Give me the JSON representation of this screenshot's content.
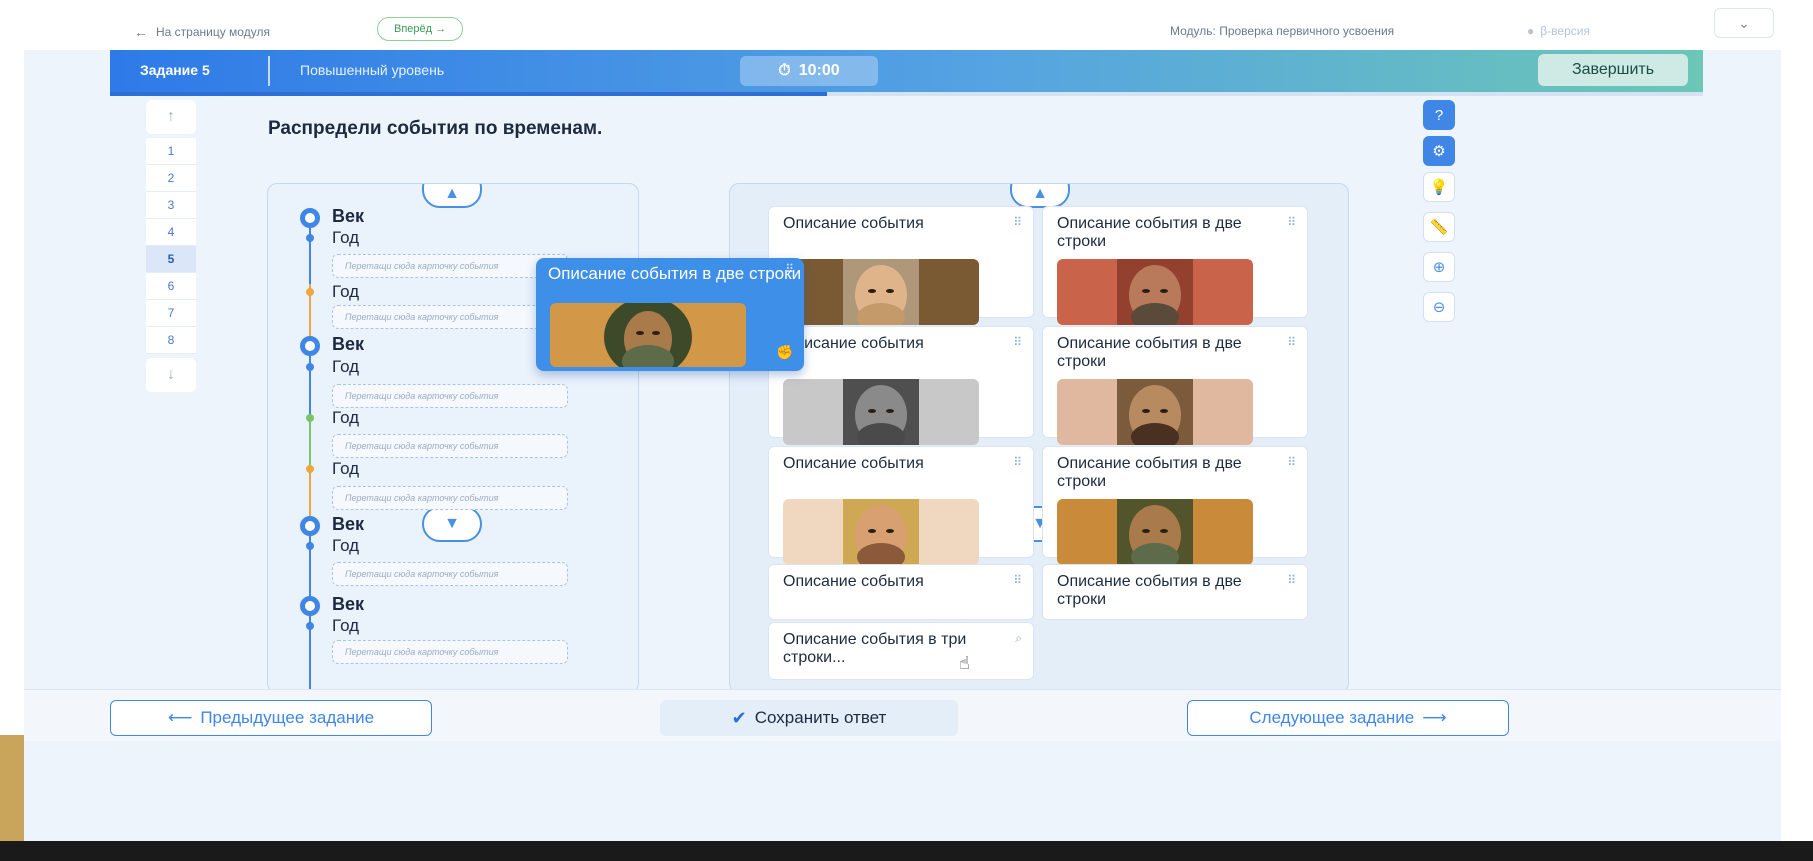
{
  "topnav": {
    "back_label": "На страницу модуля",
    "forward_label": "Вперёд",
    "module_label": "Модуль: Проверка первичного усвоения",
    "beta_label": "β-версия"
  },
  "header": {
    "task_num": "Задание 5",
    "level": "Повышенный уровень",
    "timer": "10:00",
    "finish_label": "Завершить",
    "progress_fraction": 0.45
  },
  "task_nav": {
    "items": [
      "1",
      "2",
      "3",
      "4",
      "5",
      "6",
      "7",
      "8"
    ],
    "active": "5"
  },
  "question": "Распредели события по временам.",
  "timeline": {
    "century_label": "Век",
    "year_label": "Год",
    "drop_hint": "Перетащи сюда карточку события"
  },
  "cards": {
    "one_line": "Описание события",
    "two_lines": "Описание события в две строки",
    "three_lines": "Описание события в три строки..."
  },
  "dragged_card": {
    "caption": "Описание события в две строки"
  },
  "bottom": {
    "prev_label": "Предыдущее задание",
    "save_label": "Сохранить ответ",
    "next_label": "Следующее задание"
  },
  "colors": {
    "accent": "#3f86e6",
    "timeline_blue": "#3f86e6",
    "timeline_orange": "#f0a640",
    "timeline_green": "#7bc46a"
  }
}
